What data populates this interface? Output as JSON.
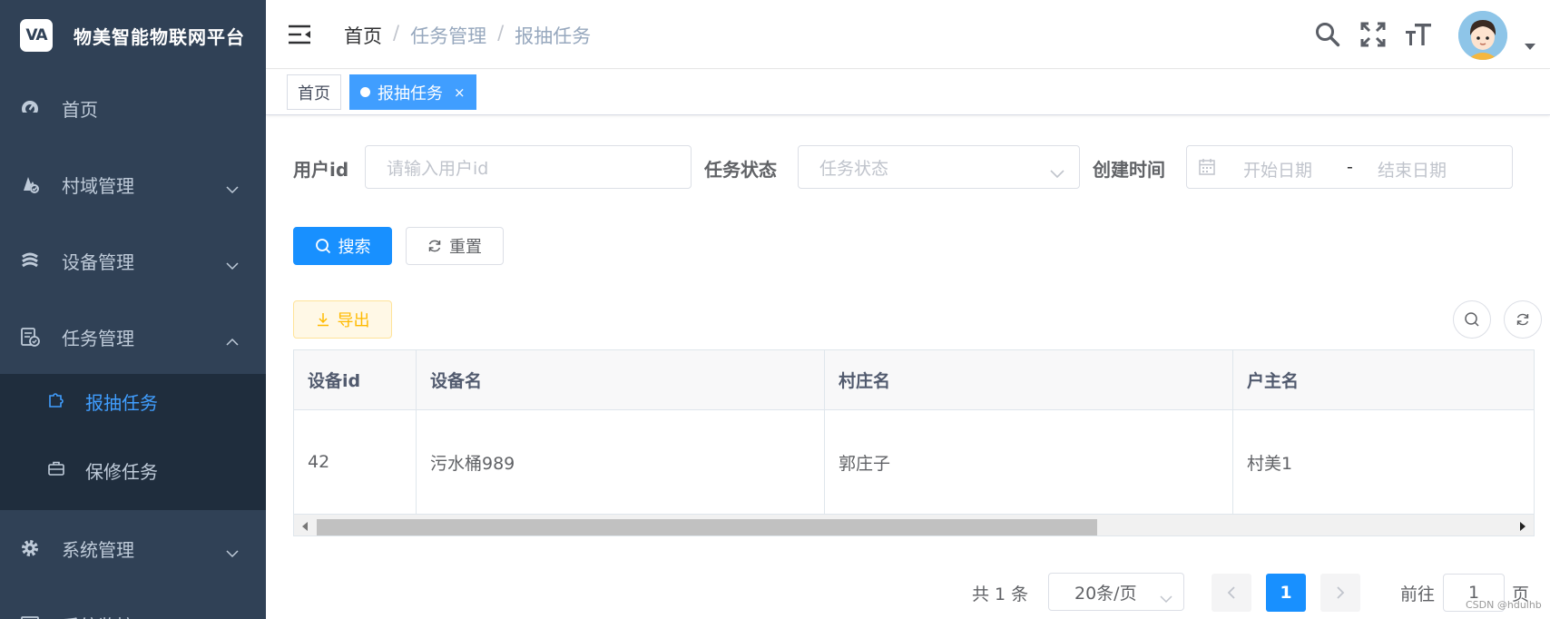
{
  "sidebar": {
    "logo_mark": "VA",
    "title": "物美智能物联网平台",
    "items": [
      {
        "label": "首页",
        "icon": "dashboard-icon"
      },
      {
        "label": "村域管理",
        "icon": "village-icon"
      },
      {
        "label": "设备管理",
        "icon": "device-icon"
      },
      {
        "label": "任务管理",
        "icon": "task-icon"
      },
      {
        "label": "系统管理",
        "icon": "gear-icon"
      },
      {
        "label": "系统监控",
        "icon": "monitor-icon"
      }
    ],
    "submenu": [
      {
        "label": "报抽任务",
        "icon": "puzzle-icon",
        "active": true
      },
      {
        "label": "保修任务",
        "icon": "briefcase-icon",
        "active": false
      }
    ]
  },
  "header": {
    "breadcrumb": [
      "首页",
      "任务管理",
      "报抽任务"
    ],
    "separator": "/"
  },
  "tags": [
    {
      "label": "首页",
      "active": false
    },
    {
      "label": "报抽任务",
      "active": true,
      "close": "×"
    }
  ],
  "search_form": {
    "user_id_label": "用户id",
    "user_id_placeholder": "请输入用户id",
    "status_label": "任务状态",
    "status_placeholder": "任务状态",
    "created_label": "创建时间",
    "start_placeholder": "开始日期",
    "range_sep": "-",
    "end_placeholder": "结束日期",
    "search_button": "搜索",
    "reset_button": "重置"
  },
  "toolbar": {
    "export_button": "导出"
  },
  "table": {
    "columns": [
      "设备id",
      "设备名",
      "村庄名",
      "户主名"
    ],
    "rows": [
      [
        "42",
        "污水桶989",
        "郭庄子",
        "村美1"
      ]
    ]
  },
  "pagination": {
    "total_text": "共 1 条",
    "page_size": "20条/页",
    "current_page": "1",
    "goto_label": "前往",
    "goto_value": "1",
    "goto_unit": "页"
  },
  "watermark": "CSDN @hdulhb",
  "colors": {
    "sidebar_bg": "#304156",
    "submenu_bg": "#1f2d3d",
    "primary": "#1890ff",
    "active_menu": "#409eff",
    "warning": "#ffba00"
  }
}
